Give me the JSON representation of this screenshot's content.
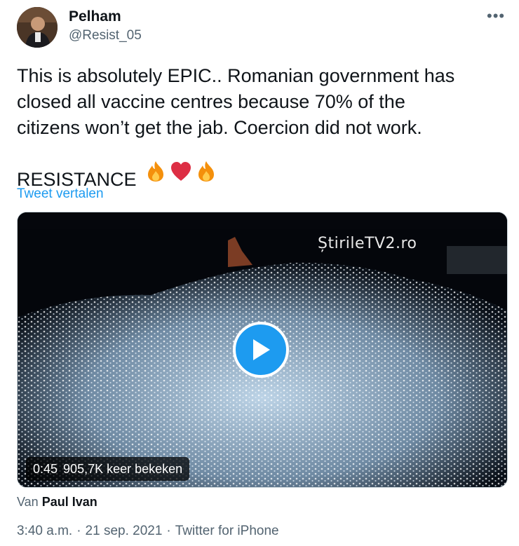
{
  "author": {
    "name": "Pelham",
    "handle": "@Resist_05"
  },
  "tweet": {
    "text": "This is absolutely EPIC.. Romanian government has\nclosed all vaccine centres because 70% of the\ncitizens won’t get the jab. Coercion did not work.\n\nRESISTANCE",
    "emojis": [
      "fire-icon",
      "heart-icon",
      "fire-icon"
    ],
    "translate_label": "Tweet vertalen"
  },
  "media": {
    "watermark": "ȘtirileTV2.ro",
    "duration": "0:45",
    "views": "905,7K keer bekeken"
  },
  "source": {
    "prefix": "Van",
    "name": "Paul Ivan"
  },
  "meta": {
    "time": "3:40 a.m.",
    "separator": "·",
    "date": "21 sep. 2021",
    "client": "Twitter for iPhone"
  },
  "colors": {
    "accent": "#1d9bf0",
    "secondary_text": "#536471",
    "heart": "#e0245e",
    "fire": "#f4900c"
  }
}
